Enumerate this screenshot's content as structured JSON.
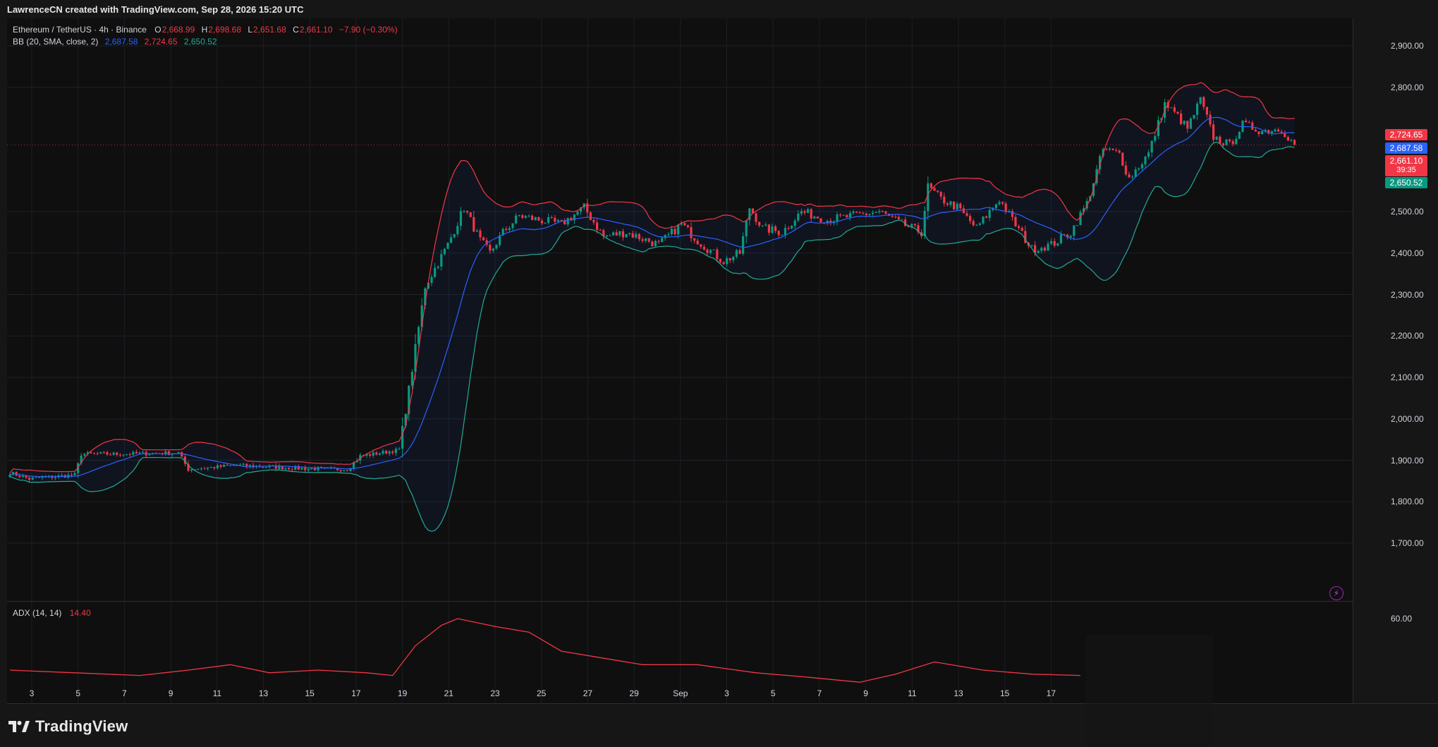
{
  "header": {
    "credit": "LawrenceCN created with TradingView.com, Sep 28, 2026 15:20 UTC"
  },
  "legend": {
    "symbol": "Ethereum / TetherUS · 4h · Binance",
    "o_label": "O",
    "o_value": "2,668.99",
    "h_label": "H",
    "h_value": "2,698.68",
    "l_label": "L",
    "l_value": "2,651.68",
    "c_label": "C",
    "c_value": "2,661.10",
    "change": "−7.90 (−0.30%)",
    "bb_label": "BB (20, SMA, close, 2)",
    "bb_basis": "2,687.58",
    "bb_upper": "2,724.65",
    "bb_lower": "2,650.52",
    "adx_label": "ADX (14, 14)",
    "adx_value": "14.40"
  },
  "price_tags": {
    "upper": "2,724.65",
    "basis": "2,687.58",
    "last": "2,661.10",
    "timer": "39:35",
    "lower": "2,650.52"
  },
  "footer": {
    "brand": "TradingView"
  },
  "colors": {
    "up": "#089981",
    "down": "#f23645",
    "basis": "#2962ff",
    "upper_band": "#f23645",
    "lower_band": "#22ab94",
    "adx": "#f23645",
    "background": "#0f0f0f"
  },
  "chart_data": [
    {
      "type": "candlestick",
      "title": "Ethereum / TetherUS · 4h · Binance",
      "ylim": [
        1650,
        2950
      ],
      "yticks": [
        "1,700.00",
        "1,800.00",
        "1,900.00",
        "2,000.00",
        "2,100.00",
        "2,200.00",
        "2,300.00",
        "2,400.00",
        "2,500.00",
        "2,800.00",
        "2,900.00"
      ],
      "xticks": [
        "3",
        "5",
        "7",
        "9",
        "11",
        "13",
        "15",
        "17",
        "19",
        "21",
        "23",
        "25",
        "27",
        "29",
        "Sep",
        "3",
        "5",
        "7",
        "9",
        "11",
        "13",
        "15",
        "17"
      ],
      "grid": true,
      "last_price": 2661.1,
      "anchors": [
        {
          "i": 0,
          "p": 1870
        },
        {
          "i": 6,
          "p": 1855
        },
        {
          "i": 20,
          "p": 1865
        },
        {
          "i": 22,
          "p": 1915
        },
        {
          "i": 34,
          "p": 1915
        },
        {
          "i": 52,
          "p": 1918
        },
        {
          "i": 55,
          "p": 1878
        },
        {
          "i": 70,
          "p": 1888
        },
        {
          "i": 90,
          "p": 1880
        },
        {
          "i": 104,
          "p": 1878
        },
        {
          "i": 108,
          "p": 1910
        },
        {
          "i": 120,
          "p": 1925
        },
        {
          "i": 124,
          "p": 2120
        },
        {
          "i": 128,
          "p": 2320
        },
        {
          "i": 135,
          "p": 2420
        },
        {
          "i": 140,
          "p": 2510
        },
        {
          "i": 145,
          "p": 2430
        },
        {
          "i": 148,
          "p": 2400
        },
        {
          "i": 152,
          "p": 2450
        },
        {
          "i": 157,
          "p": 2490
        },
        {
          "i": 163,
          "p": 2480
        },
        {
          "i": 170,
          "p": 2470
        },
        {
          "i": 177,
          "p": 2510
        },
        {
          "i": 183,
          "p": 2440
        },
        {
          "i": 190,
          "p": 2450
        },
        {
          "i": 200,
          "p": 2420
        },
        {
          "i": 207,
          "p": 2470
        },
        {
          "i": 212,
          "p": 2430
        },
        {
          "i": 220,
          "p": 2380
        },
        {
          "i": 225,
          "p": 2400
        },
        {
          "i": 228,
          "p": 2510
        },
        {
          "i": 232,
          "p": 2460
        },
        {
          "i": 238,
          "p": 2450
        },
        {
          "i": 244,
          "p": 2500
        },
        {
          "i": 252,
          "p": 2480
        },
        {
          "i": 260,
          "p": 2490
        },
        {
          "i": 268,
          "p": 2500
        },
        {
          "i": 275,
          "p": 2470
        },
        {
          "i": 281,
          "p": 2450
        },
        {
          "i": 283,
          "p": 2560
        },
        {
          "i": 287,
          "p": 2530
        },
        {
          "i": 292,
          "p": 2510
        },
        {
          "i": 298,
          "p": 2460
        },
        {
          "i": 305,
          "p": 2530
        },
        {
          "i": 309,
          "p": 2480
        },
        {
          "i": 315,
          "p": 2410
        },
        {
          "i": 321,
          "p": 2420
        },
        {
          "i": 327,
          "p": 2450
        },
        {
          "i": 332,
          "p": 2520
        },
        {
          "i": 337,
          "p": 2650
        },
        {
          "i": 342,
          "p": 2640
        },
        {
          "i": 345,
          "p": 2580
        },
        {
          "i": 351,
          "p": 2640
        },
        {
          "i": 356,
          "p": 2760
        },
        {
          "i": 360,
          "p": 2730
        },
        {
          "i": 363,
          "p": 2700
        },
        {
          "i": 367,
          "p": 2770
        },
        {
          "i": 371,
          "p": 2680
        },
        {
          "i": 376,
          "p": 2660
        },
        {
          "i": 380,
          "p": 2710
        },
        {
          "i": 386,
          "p": 2695
        },
        {
          "i": 392,
          "p": 2700
        },
        {
          "i": 396,
          "p": 2660
        }
      ],
      "indicators": [
        {
          "name": "BB (20, SMA, close, 2)",
          "basis": 2687.58,
          "upper": 2724.65,
          "lower": 2650.52
        }
      ]
    },
    {
      "type": "line",
      "title": "ADX (14, 14)",
      "yticks": [
        "60.00"
      ],
      "last_value": 14.4,
      "ylim": [
        8,
        66
      ],
      "points": [
        {
          "i": 0,
          "v": 22
        },
        {
          "i": 20,
          "v": 20
        },
        {
          "i": 40,
          "v": 18
        },
        {
          "i": 55,
          "v": 22
        },
        {
          "i": 68,
          "v": 26
        },
        {
          "i": 80,
          "v": 20
        },
        {
          "i": 95,
          "v": 22
        },
        {
          "i": 110,
          "v": 20
        },
        {
          "i": 118,
          "v": 18
        },
        {
          "i": 125,
          "v": 40
        },
        {
          "i": 133,
          "v": 55
        },
        {
          "i": 138,
          "v": 60
        },
        {
          "i": 150,
          "v": 54
        },
        {
          "i": 160,
          "v": 50
        },
        {
          "i": 170,
          "v": 36
        },
        {
          "i": 180,
          "v": 32
        },
        {
          "i": 195,
          "v": 26
        },
        {
          "i": 212,
          "v": 26
        },
        {
          "i": 230,
          "v": 20
        },
        {
          "i": 245,
          "v": 17
        },
        {
          "i": 262,
          "v": 13
        },
        {
          "i": 273,
          "v": 19
        },
        {
          "i": 285,
          "v": 28
        },
        {
          "i": 300,
          "v": 22
        },
        {
          "i": 315,
          "v": 19
        },
        {
          "i": 330,
          "v": 18
        }
      ]
    }
  ]
}
